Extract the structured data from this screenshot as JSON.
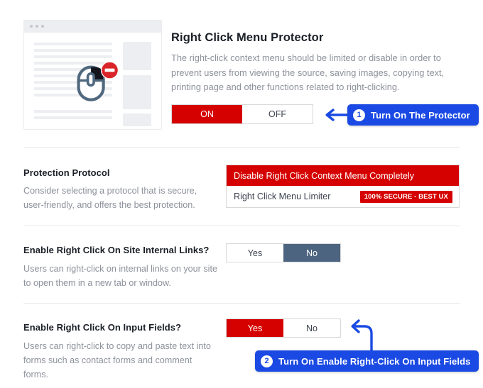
{
  "hero": {
    "title": "Right Click Menu Protector",
    "description": "The right-click context menu should be limited or disable in order to prevent users from viewing the source, saving images, copying text, printing page and other functions related to right-clicking.",
    "toggle": {
      "on_label": "ON",
      "off_label": "OFF",
      "selected": "ON"
    },
    "illustration": {
      "name": "right-click-disabled-illustration"
    }
  },
  "callouts": [
    {
      "number": "1",
      "text": "Turn On The Protector"
    },
    {
      "number": "2",
      "text": "Turn On Enable Right-Click On Input Fields"
    }
  ],
  "settings": [
    {
      "label": "Protection Protocol",
      "description": "Consider selecting a protocol that is secure, user-friendly, and offers the best protection.",
      "selected_option": "Disable Right Click Context Menu Completely",
      "option": "Right Click Menu Limiter",
      "badge": "100% SECURE - BEST UX"
    },
    {
      "label": "Enable Right Click On Site Internal Links?",
      "description": "Users can right-click on internal links on your site to open them in a new tab or window.",
      "yes_label": "Yes",
      "no_label": "No",
      "selected": "No"
    },
    {
      "label": "Enable Right Click On Input Fields?",
      "description": "Users can right-click to copy and paste text into forms such as contact forms and comment forms.",
      "yes_label": "Yes",
      "no_label": "No",
      "selected": "Yes"
    }
  ],
  "colors": {
    "accent_red": "#d50000",
    "accent_blue": "#1a4ae3",
    "slate": "#4d6480",
    "muted_text": "#8d919b"
  }
}
